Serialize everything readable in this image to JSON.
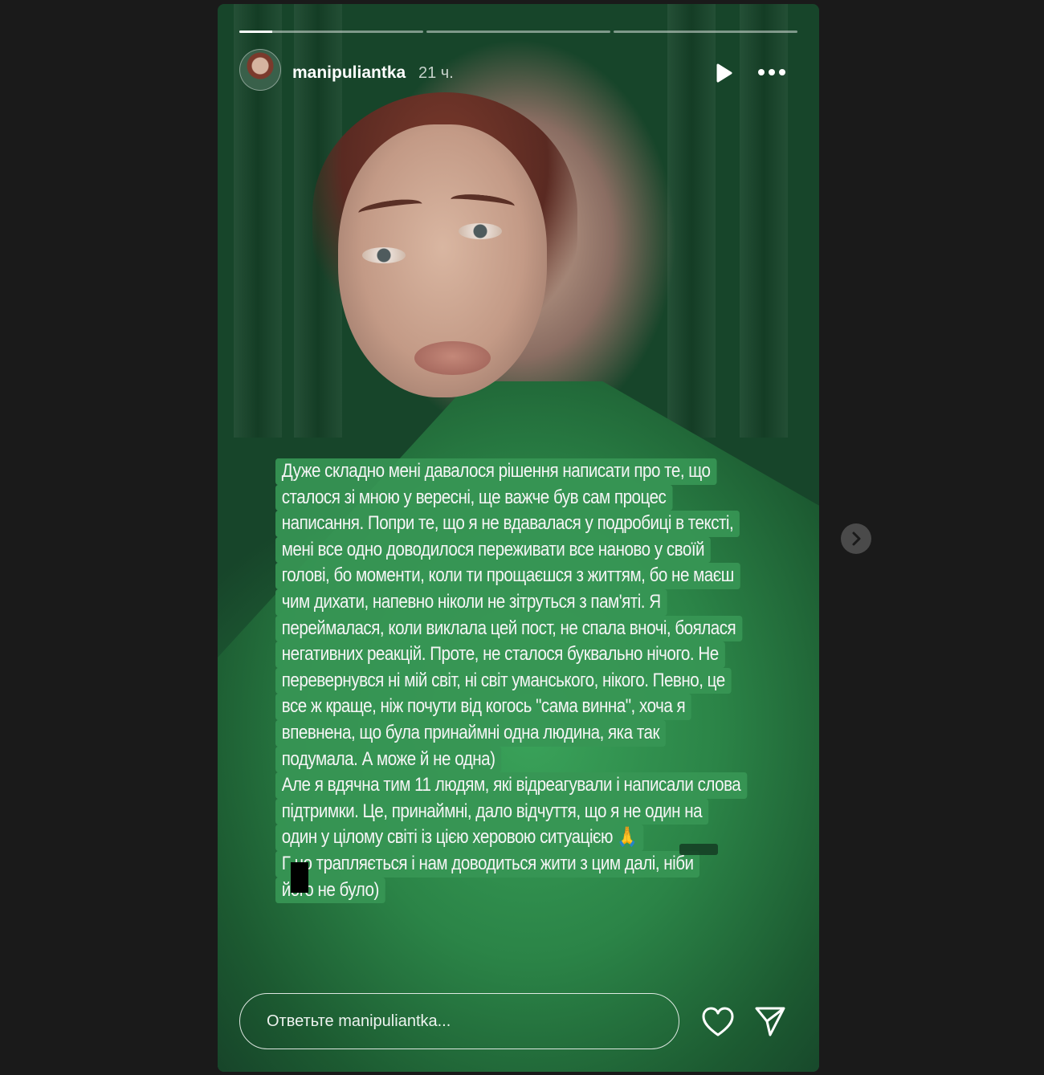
{
  "story": {
    "progress": [
      {
        "label": "segment-1",
        "fill": 0.18
      },
      {
        "label": "segment-2",
        "fill": 0
      },
      {
        "label": "segment-3",
        "fill": 0
      }
    ],
    "username": "manipuliantka",
    "time": "21 ч.",
    "text_lines": [
      "Дуже складно мені давалося рішення написати про те, що",
      "сталося зі мною у вересні, ще важче був сам процес",
      "написання. Попри те, що я не вдавалася у подробиці в тексті,",
      "мені все одно доводилося переживати все наново у своїй",
      "голові, бо моменти, коли ти прощаєшся з життям, бо не маєш",
      "чим дихати, напевно ніколи не зітруться з пам'яті. Я",
      "переймалася, коли виклала цей пост, не спала вночі, боялася",
      "негативних реакцій. Проте, не сталося буквально нічого. Не",
      "перевернувся ні мій світ, ні світ уманського, нікого. Певно, це",
      "все ж краще, ніж почути від когось \"сама винна\", хоча я",
      "впевнена, що була принаймні одна людина, яка так",
      "подумала. А може й не одна)",
      "Але я вдячна тим 11 людям, які відреагували і написали слова",
      "підтримки. Це, принаймні, дало відчуття, що я не один на",
      "один у цілому світі із цією херовою ситуацією 🙏",
      "Г   но трапляється і нам доводиться жити з цим далі, ніби",
      "його не було)"
    ],
    "reply_placeholder": "Ответьте manipuliantka..."
  },
  "icons": {
    "play": "play-icon",
    "more": "more-icon",
    "heart": "heart-icon",
    "send": "send-icon",
    "next": "chevron-right-icon"
  },
  "colors": {
    "page_background": "#1a1a1a",
    "text_card": "#3a9a58",
    "text": "#f5f5f5"
  }
}
